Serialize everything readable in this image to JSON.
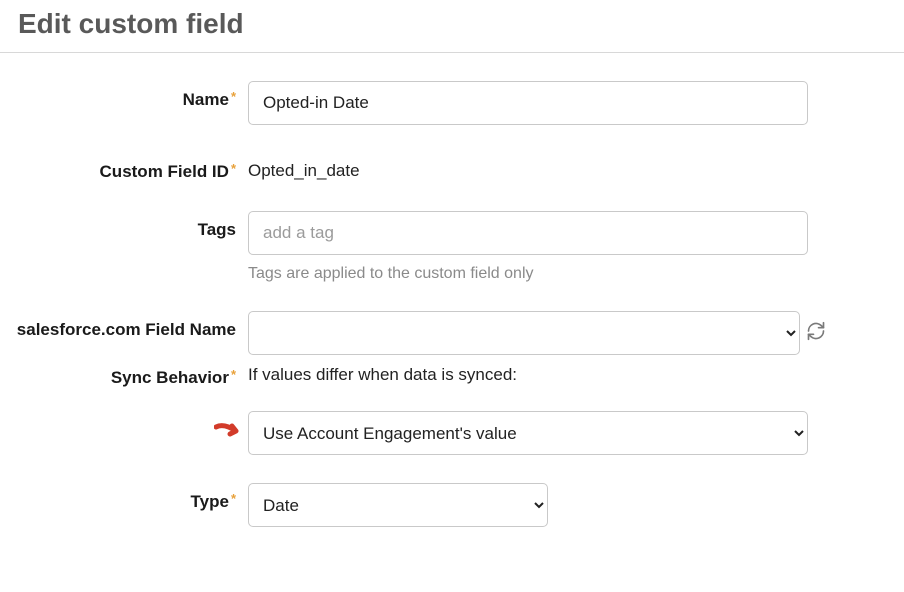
{
  "page": {
    "title": "Edit custom field"
  },
  "labels": {
    "name": "Name",
    "custom_field_id": "Custom Field ID",
    "tags": "Tags",
    "salesforce_field_name": "salesforce.com Field Name",
    "sync_behavior": "Sync Behavior",
    "type": "Type",
    "asterisk": "*"
  },
  "values": {
    "name": "Opted-in Date",
    "custom_field_id": "Opted_in_date",
    "tags_placeholder": "add a tag",
    "tags_help": "Tags are applied to the custom field only",
    "salesforce_field_name": "",
    "sync_behavior_desc": "If values differ when data is synced:",
    "sync_behavior_selected": "Use Account Engagement's value",
    "type_selected": "Date"
  }
}
